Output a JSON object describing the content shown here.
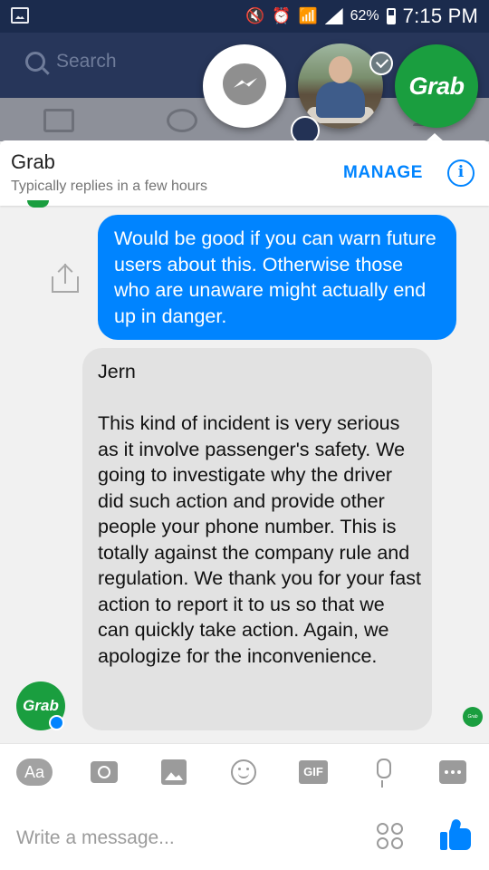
{
  "status_bar": {
    "battery_pct": "62%",
    "time": "7:15 PM"
  },
  "background_app": {
    "search_placeholder": "Search"
  },
  "chat_heads": [
    {
      "name": "messenger"
    },
    {
      "name": "contact-photo"
    },
    {
      "name": "Grab",
      "label": "Grab"
    }
  ],
  "header": {
    "title": "Grab",
    "subtitle": "Typically replies in a few hours",
    "manage_label": "MANAGE",
    "info_icon": "info-icon"
  },
  "messages": [
    {
      "direction": "outgoing",
      "text": "Would be good if you can warn future users about this. Otherwise those who are unaware might actually end up in danger."
    },
    {
      "direction": "incoming",
      "sender": "Grab",
      "text": "Jern\n\nThis kind of incident is very serious as it involve passenger's safety. We going to investigate why the driver did such action and provide other people your phone number. This is totally against the company rule and regulation. We thank you for your fast action to report it to us so that we can quickly take action. Again, we apologize for the inconvenience."
    }
  ],
  "avatar_label": "Grab",
  "toolbar": {
    "text_button_label": "Aa",
    "gif_label": "GIF",
    "icons": [
      "aa-icon",
      "camera-icon",
      "image-icon",
      "emoji-icon",
      "gif-icon",
      "microphone-icon",
      "more-icon"
    ]
  },
  "composer": {
    "placeholder": "Write a message..."
  },
  "colors": {
    "messenger_blue": "#0084ff",
    "grab_green": "#1a9e3f",
    "status_bar": "#1b2b4d"
  }
}
